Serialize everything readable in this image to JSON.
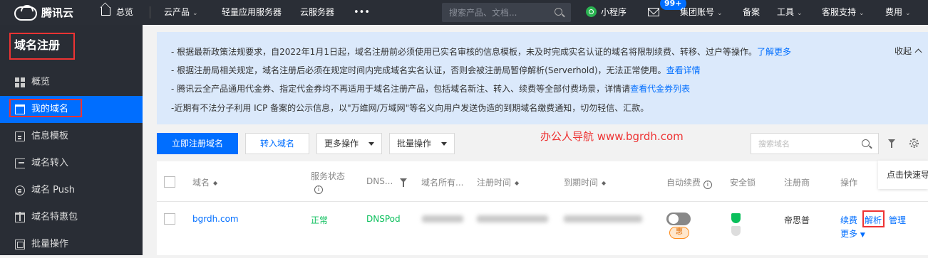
{
  "topnav": {
    "brand": "腾讯云",
    "overview": "总览",
    "cloud_products": "云产品",
    "lighthouse": "轻量应用服务器",
    "cvm": "云服务器",
    "more": "•••",
    "search_placeholder": "搜索产品、文档...",
    "mini_program": "小程序",
    "mail_badge": "99+",
    "group_account": "集团账号",
    "beian": "备案",
    "tools": "工具",
    "support": "客服支持",
    "billing": "费用"
  },
  "sidebar": {
    "title": "域名注册",
    "items": [
      {
        "label": "概览"
      },
      {
        "label": "我的域名"
      },
      {
        "label": "信息模板"
      },
      {
        "label": "域名转入"
      },
      {
        "label": "域名 Push"
      },
      {
        "label": "域名特惠包"
      },
      {
        "label": "批量操作"
      }
    ]
  },
  "notice": {
    "line1": "- 根据最新政策法规要求，自2022年1月1日起，域名注册前必须使用已实名审核的信息模板，未及时完成实名认证的域名将限制续费、转移、过户等操作。",
    "line1_link": "了解更多",
    "line2": "- 根据注册局相关规定，域名注册后必须在规定时间内完成域名实名认证，否则会被注册局暂停解析(Serverhold)，无法正常使用。",
    "line2_link": "查看详情",
    "line3": "- 腾讯云全产品通用代金券、指定代金券均不再适用于域名注册产品，包括域名新注、转入、续费等全部付费场景，详情请",
    "line3_link": "查看代金券列表",
    "line4": "-近期有不法分子利用 ICP 备案的公示信息，以\"万维网/万域网\"等名义向用户发送伪造的到期域名缴费通知，切勿轻信、汇款。",
    "collapse": "收起"
  },
  "toolbar": {
    "register": "立即注册域名",
    "transfer": "转入域名",
    "more_ops": "更多操作",
    "batch_ops": "批量操作",
    "search_placeholder": "搜索域名",
    "watermark": "办公人导航 www.bgrdh.com"
  },
  "table": {
    "headers": {
      "domain": "域名",
      "status_line1": "服务状态",
      "dns": "DNS...",
      "owner": "域名所有...",
      "reg_time": "注册时间",
      "exp_time": "到期时间",
      "auto_renew": "自动续费",
      "lock": "安全锁",
      "registrar": "注册商",
      "ops": "操作"
    },
    "row": {
      "domain": "bgrdh.com",
      "status": "正常",
      "dns": "DNSPod",
      "discount": "惠",
      "registrar": "帝思普",
      "renew": "续费",
      "resolve": "解析",
      "manage": "管理",
      "more": "更多"
    }
  },
  "tooltip": "点击快速导"
}
